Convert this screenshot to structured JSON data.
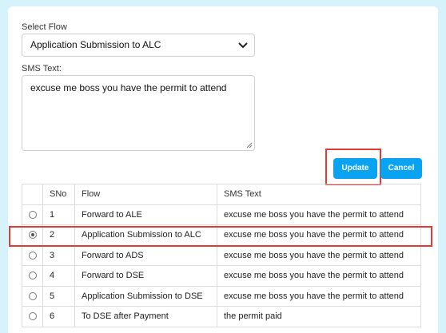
{
  "form": {
    "flow_label": "Select Flow",
    "flow_value": "Application Submission to ALC",
    "sms_label": "SMS Text:",
    "sms_value": "excuse me boss you have the permit to attend"
  },
  "buttons": {
    "update_label": "Update",
    "cancel_label": "Cancel"
  },
  "table": {
    "headers": [
      "SNo",
      "Flow",
      "SMS Text"
    ],
    "rows": [
      {
        "sno": "1",
        "flow": "Forward to ALE",
        "sms": "excuse me boss you have the permit to attend",
        "selected": false
      },
      {
        "sno": "2",
        "flow": "Application Submission to ALC",
        "sms": "excuse me boss you have the permit to attend",
        "selected": true
      },
      {
        "sno": "3",
        "flow": "Forward to ADS",
        "sms": "excuse me boss you have the permit to attend",
        "selected": false
      },
      {
        "sno": "4",
        "flow": "Forward to DSE",
        "sms": "excuse me boss you have the permit to attend",
        "selected": false
      },
      {
        "sno": "5",
        "flow": "Application Submission to DSE",
        "sms": "excuse me boss you have the permit to attend",
        "selected": false
      },
      {
        "sno": "6",
        "flow": "To DSE after Payment",
        "sms": "the permit paid",
        "selected": false
      }
    ]
  },
  "colors": {
    "accent": "#0aa3f2",
    "highlight": "#e53935",
    "background": "#d6f2fb"
  }
}
